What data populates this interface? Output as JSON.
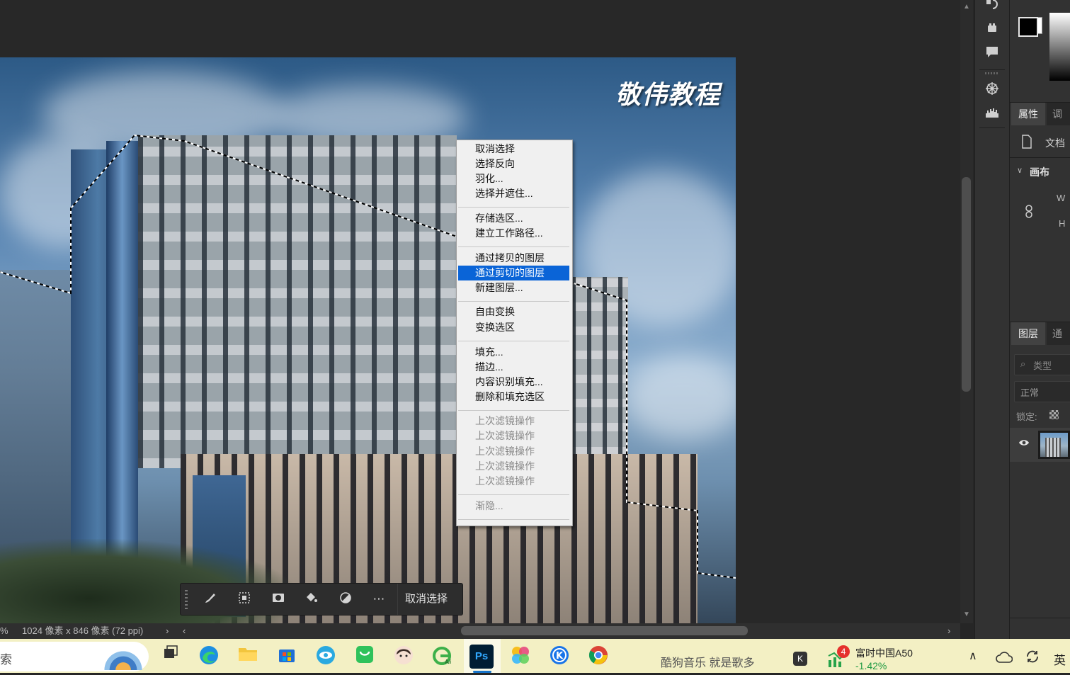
{
  "canvas": {
    "watermark": "敬伟教程"
  },
  "context_menu": {
    "items": [
      {
        "label": "取消选择",
        "enabled": true
      },
      {
        "label": "选择反向",
        "enabled": true
      },
      {
        "label": "羽化...",
        "enabled": true
      },
      {
        "label": "选择并遮住...",
        "enabled": true
      },
      {
        "label": "存储选区...",
        "enabled": true
      },
      {
        "label": "建立工作路径...",
        "enabled": true
      },
      {
        "label": "通过拷贝的图层",
        "enabled": true
      },
      {
        "label": "通过剪切的图层",
        "enabled": true,
        "highlighted": true
      },
      {
        "label": "新建图层...",
        "enabled": true
      },
      {
        "label": "自由变换",
        "enabled": true
      },
      {
        "label": "变换选区",
        "enabled": true
      },
      {
        "label": "填充...",
        "enabled": true
      },
      {
        "label": "描边...",
        "enabled": true
      },
      {
        "label": "内容识别填充...",
        "enabled": true
      },
      {
        "label": "删除和填充选区",
        "enabled": true
      },
      {
        "label": "上次滤镜操作",
        "enabled": false
      },
      {
        "label": "上次滤镜操作",
        "enabled": false
      },
      {
        "label": "上次滤镜操作",
        "enabled": false
      },
      {
        "label": "上次滤镜操作",
        "enabled": false
      },
      {
        "label": "上次滤镜操作",
        "enabled": false
      },
      {
        "label": "渐隐...",
        "enabled": false
      }
    ],
    "highlight_color": "#0a64d7"
  },
  "contextual_taskbar": {
    "buttons": [
      "brush-icon",
      "transform-selection-icon",
      "mask-icon",
      "fill-bucket-icon",
      "adjustment-icon",
      "more-icon"
    ],
    "deselect_label": "取消选择"
  },
  "status_bar": {
    "zoom_fragment": "%",
    "doc_info": "1024 像素 x 846 像素 (72 ppi)",
    "arrow": "›",
    "scroll_left": "‹",
    "scroll_right": "›"
  },
  "right_panel": {
    "properties_tab": "属性",
    "adjust_tab": "调整",
    "doc_label": "文档",
    "canvas_section": "画布",
    "w_label": "W",
    "h_label": "H",
    "layers_tab": "图层",
    "channels_tab": "通道",
    "filter_placeholder": "类型",
    "blend_mode": "正常",
    "lock_label": "锁定:"
  },
  "windows_taskbar": {
    "search_fragment": "索",
    "music_text": "酷狗音乐 就是歌多",
    "stock_name": "富时中国A50",
    "stock_change": "-1.42%",
    "stock_badge": "4",
    "ime": "英",
    "ps_label": "Ps"
  }
}
